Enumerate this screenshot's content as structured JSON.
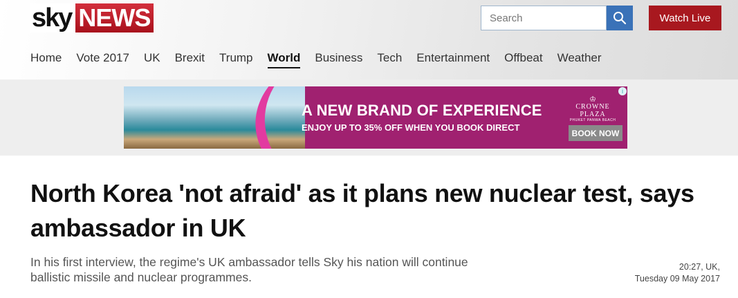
{
  "brand": {
    "logo_sky": "sky",
    "logo_news": "NEWS"
  },
  "header": {
    "search_placeholder": "Search",
    "search_icon": "search-icon",
    "watch_live_label": "Watch Live"
  },
  "nav": {
    "items": [
      {
        "label": "Home"
      },
      {
        "label": "Vote 2017"
      },
      {
        "label": "UK"
      },
      {
        "label": "Brexit"
      },
      {
        "label": "Trump"
      },
      {
        "label": "World",
        "active": true
      },
      {
        "label": "Business"
      },
      {
        "label": "Tech"
      },
      {
        "label": "Entertainment"
      },
      {
        "label": "Offbeat"
      },
      {
        "label": "Weather"
      }
    ]
  },
  "advert": {
    "headline": "A NEW BRAND OF EXPERIENCE",
    "subline": "ENJOY UP TO 35% OFF WHEN YOU BOOK DIRECT",
    "brand_name": "CROWNE PLAZA",
    "brand_location": "PHUKET PANWA BEACH",
    "cta_label": "BOOK NOW",
    "info_icon": "info-icon"
  },
  "article": {
    "headline": "North Korea 'not afraid' as it plans new nuclear test, says ambassador in UK",
    "standfirst": "In his first interview, the regime's UK ambassador tells Sky his nation will continue ballistic missile and nuclear programmes.",
    "time": "20:27, UK,",
    "date": "Tuesday 09 May 2017"
  },
  "colors": {
    "brand_red": "#a8181f",
    "search_blue": "#3a72b8",
    "ad_magenta": "#a02170"
  }
}
